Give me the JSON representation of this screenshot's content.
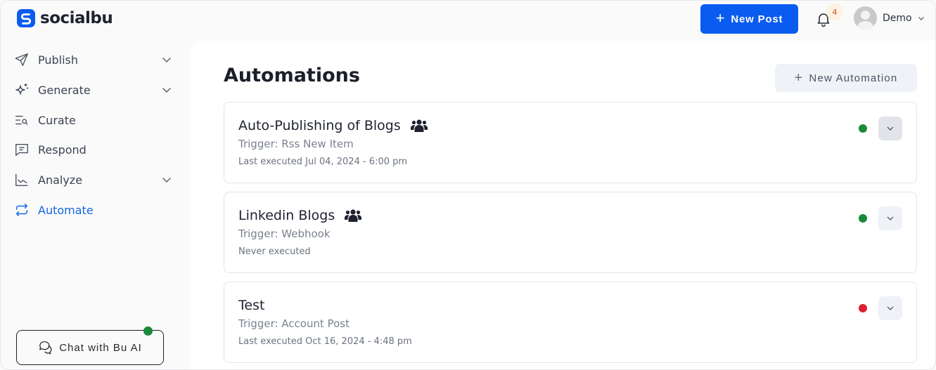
{
  "header": {
    "brand": "socialbu",
    "new_post_label": "New Post",
    "notifications_count": "4",
    "user_name": "Demo",
    "brand_color": "#0a5bf0"
  },
  "sidebar": {
    "items": [
      {
        "label": "Publish",
        "icon": "paper-plane-icon",
        "has_submenu": true,
        "active": false
      },
      {
        "label": "Generate",
        "icon": "sparkles-icon",
        "has_submenu": true,
        "active": false
      },
      {
        "label": "Curate",
        "icon": "list-search-icon",
        "has_submenu": false,
        "active": false
      },
      {
        "label": "Respond",
        "icon": "message-icon",
        "has_submenu": false,
        "active": false
      },
      {
        "label": "Analyze",
        "icon": "chart-line-icon",
        "has_submenu": true,
        "active": false
      },
      {
        "label": "Automate",
        "icon": "repeat-icon",
        "has_submenu": false,
        "active": true
      }
    ],
    "chat_label": "Chat with Bu AI"
  },
  "main": {
    "title": "Automations",
    "new_automation_label": "New Automation",
    "automations": [
      {
        "name": "Auto-Publishing of Blogs",
        "shared": true,
        "trigger": "Trigger: Rss New Item",
        "executed": "Last executed Jul 04, 2024 - 6:00 pm",
        "status": "active",
        "status_color": "#1a8a3a"
      },
      {
        "name": "Linkedin Blogs",
        "shared": true,
        "trigger": "Trigger: Webhook",
        "executed": "Never executed",
        "status": "active",
        "status_color": "#1a8a3a"
      },
      {
        "name": "Test",
        "shared": false,
        "trigger": "Trigger: Account Post",
        "executed": "Last executed Oct 16, 2024 - 4:48 pm",
        "status": "inactive",
        "status_color": "#dc1f32"
      }
    ]
  }
}
